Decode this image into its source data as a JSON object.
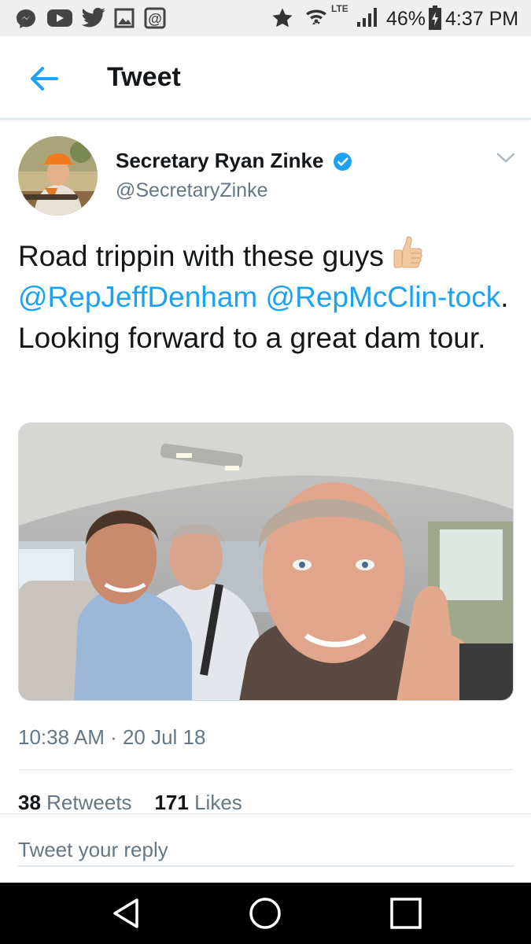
{
  "status_bar": {
    "notification_icons": [
      "messenger-icon",
      "youtube-icon",
      "twitter-icon",
      "gallery-icon",
      "at-sign-icon"
    ],
    "battery_percent": "46%",
    "time": "4:37 PM",
    "network": "LTE"
  },
  "header": {
    "title": "Tweet"
  },
  "tweet": {
    "author_name": "Secretary Ryan Zinke",
    "handle": "@SecretaryZinke",
    "text": {
      "part1": "Road trippin with these guys ",
      "mention1": "@RepJeffDenham",
      "part2": " ",
      "mention2": "@RepMcClin-tock",
      "part3": ". Looking forward to a great dam tour."
    },
    "timestamp": "10:38 AM · 20 Jul 18",
    "retweets_count": "38",
    "retweets_label": "Retweets",
    "likes_count": "171",
    "likes_label": "Likes"
  },
  "reply": {
    "placeholder": "Tweet your reply"
  },
  "colors": {
    "accent": "#1da1f2",
    "text": "#14171a",
    "muted": "#657786",
    "divider": "#e1e8ed"
  }
}
